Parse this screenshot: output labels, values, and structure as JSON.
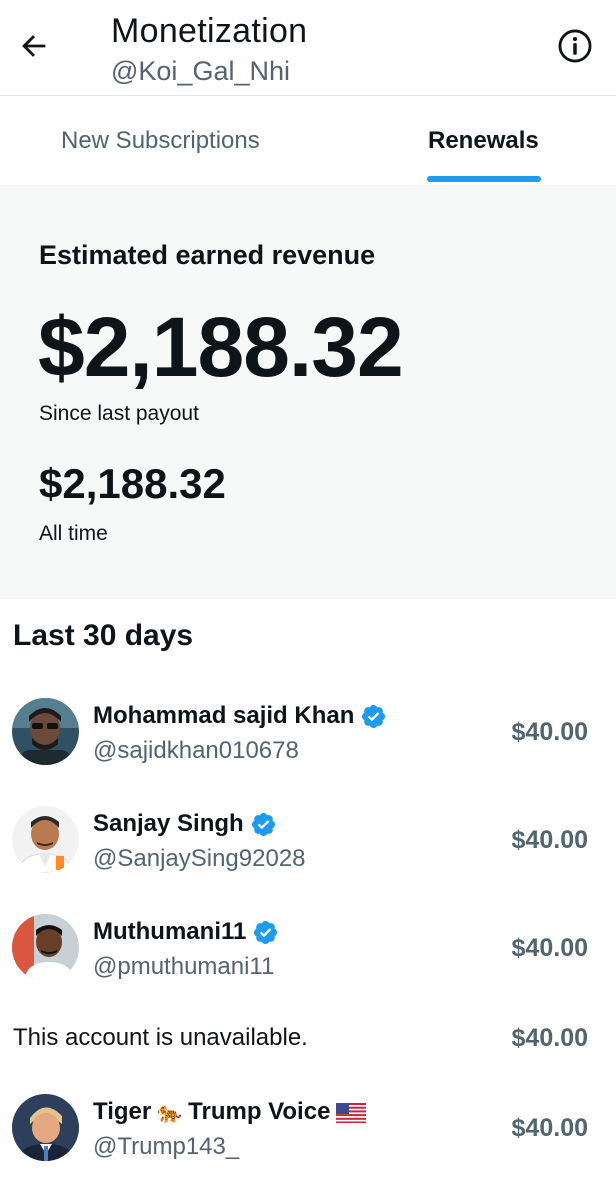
{
  "header": {
    "title": "Monetization",
    "handle": "@Koi_Gal_Nhi",
    "back_icon": "arrow-left-icon",
    "info_icon": "info-circle-icon"
  },
  "tabs": [
    {
      "label": "New Subscriptions",
      "active": false
    },
    {
      "label": "Renewals",
      "active": true
    }
  ],
  "revenue": {
    "heading": "Estimated earned revenue",
    "since_payout_amount": "$2,188.32",
    "since_payout_label": "Since last payout",
    "all_time_amount": "$2,188.32",
    "all_time_label": "All time"
  },
  "list": {
    "title": "Last 30 days",
    "items": [
      {
        "name": "Mohammad sajid Khan",
        "handle": "@sajidkhan010678",
        "amount": "$40.00",
        "verified": true
      },
      {
        "name": "Sanjay Singh",
        "handle": "@SanjaySing92028",
        "amount": "$40.00",
        "verified": true
      },
      {
        "name": "Muthumani11",
        "handle": "@pmuthumani11",
        "amount": "$40.00",
        "verified": true
      },
      {
        "text": "This account is unavailable.",
        "amount": "$40.00"
      },
      {
        "name_part1": "Tiger",
        "emoji": "🐅",
        "name_part2": "Trump Voice",
        "flag": "us-flag-icon",
        "handle": "@Trump143_",
        "amount": "$40.00"
      }
    ]
  },
  "colors": {
    "accent": "#1d9bf0",
    "verified": "#1d9bf0",
    "text_primary": "#0f1419",
    "text_secondary": "#536471",
    "panel_bg": "#f7f9f9"
  }
}
